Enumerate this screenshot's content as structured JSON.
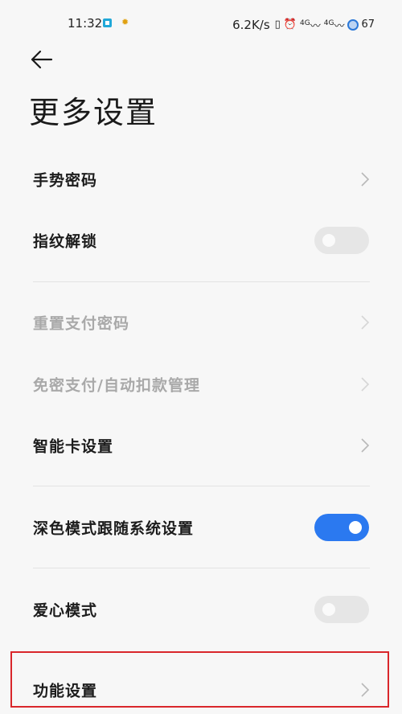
{
  "status_bar": {
    "time": "11:32",
    "net_speed": "6.2K/s",
    "signal1": "4G",
    "signal2": "4G",
    "battery_level": "67"
  },
  "header": {
    "title": "更多设置"
  },
  "settings": {
    "gesture_password": "手势密码",
    "fingerprint_unlock": "指纹解锁",
    "reset_pay_password": "重置支付密码",
    "password_free_pay": "免密支付/自动扣款管理",
    "smart_card": "智能卡设置",
    "dark_mode_follow": "深色模式跟随系统设置",
    "love_mode": "爱心模式",
    "function_settings": "功能设置"
  },
  "toggles": {
    "fingerprint_unlock": false,
    "dark_mode_follow": true,
    "love_mode": false
  },
  "colors": {
    "accent": "#2b79f0",
    "highlight_border": "#d9262b",
    "disabled_text": "#a9a9a9"
  }
}
